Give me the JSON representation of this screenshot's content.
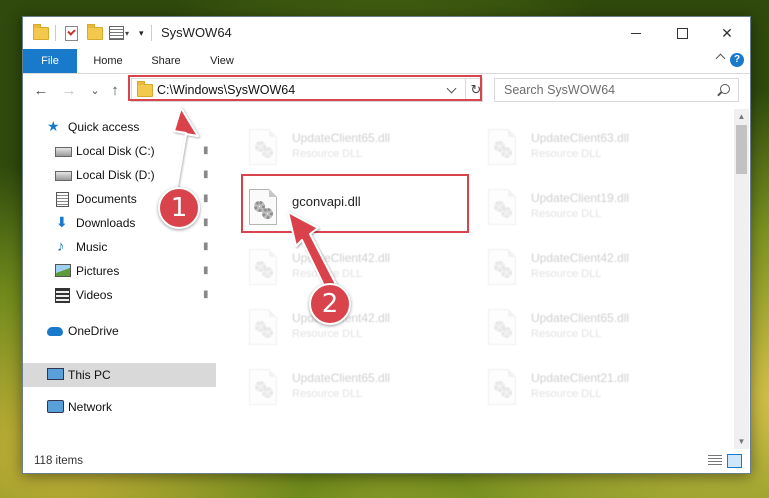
{
  "window": {
    "title": "SysWOW64",
    "minimize_icon": "minimize-icon",
    "maximize_icon": "maximize-icon",
    "close_glyph": "✕"
  },
  "ribbon": {
    "tabs": [
      "File",
      "Home",
      "Share",
      "View"
    ],
    "help_glyph": "?"
  },
  "nav": {
    "back_glyph": "←",
    "forward_glyph": "→",
    "recent_glyph": "⌄",
    "up_glyph": "↑",
    "address": "C:\\Windows\\SysWOW64",
    "refresh_glyph": "↻",
    "search_placeholder": "Search SysWOW64"
  },
  "sidebar": {
    "items": [
      {
        "label": "Quick access",
        "icon": "star-icon"
      },
      {
        "label": "Local Disk (C:)",
        "icon": "disk-icon",
        "pinned": true
      },
      {
        "label": "Local Disk (D:)",
        "icon": "disk-icon",
        "pinned": true
      },
      {
        "label": "Documents",
        "icon": "documents-icon",
        "pinned": true
      },
      {
        "label": "Downloads",
        "icon": "downloads-icon",
        "pinned": true
      },
      {
        "label": "Music",
        "icon": "music-icon",
        "pinned": true
      },
      {
        "label": "Pictures",
        "icon": "pictures-icon",
        "pinned": true
      },
      {
        "label": "Videos",
        "icon": "videos-icon",
        "pinned": true
      },
      {
        "label": "OneDrive",
        "icon": "onedrive-icon"
      },
      {
        "label": "This PC",
        "icon": "computer-icon",
        "selected": true
      },
      {
        "label": "Network",
        "icon": "network-icon"
      }
    ],
    "pin_glyph": "📌"
  },
  "files": {
    "highlighted": {
      "name": "gconvapi.dll"
    },
    "blurred_left": [
      {
        "name": "UpdateClient65.dll",
        "type": "Resource DLL"
      },
      {
        "name": "UpdateClient42.dll",
        "type": "Resource DLL"
      },
      {
        "name": "UpdateClient42.dll",
        "type": "Resource DLL"
      },
      {
        "name": "UpdateClient65.dll",
        "type": "Resource DLL"
      }
    ],
    "blurred_right": [
      {
        "name": "UpdateClient63.dll",
        "type": "Resource DLL"
      },
      {
        "name": "UpdateClient19.dll",
        "type": "Resource DLL"
      },
      {
        "name": "UpdateClient42.dll",
        "type": "Resource DLL"
      },
      {
        "name": "UpdateClient65.dll",
        "type": "Resource DLL"
      },
      {
        "name": "UpdateClient21.dll",
        "type": "Resource DLL"
      }
    ]
  },
  "status": {
    "item_count": "118 items"
  },
  "annotations": {
    "step1": "1",
    "step2": "2",
    "color": "#d9434c"
  }
}
